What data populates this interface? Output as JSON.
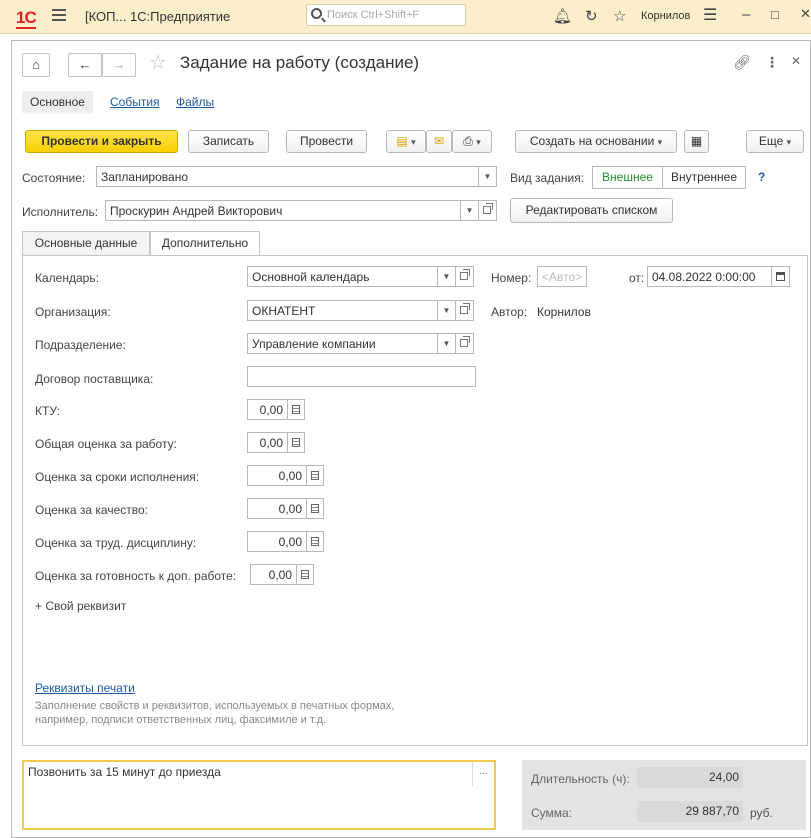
{
  "appbar": {
    "logo": "1С",
    "title": "[КОП... 1С:Предприятие",
    "search_placeholder": "Поиск Ctrl+Shift+F",
    "user": "Корнилов"
  },
  "window": {
    "title": "Задание на работу (создание)"
  },
  "top_tabs": [
    {
      "label": "Основное"
    },
    {
      "label": "События"
    },
    {
      "label": "Файлы"
    }
  ],
  "toolbar": {
    "post_close": "Провести и закрыть",
    "save": "Записать",
    "post": "Провести",
    "create_based": "Создать на основании",
    "more": "Еще"
  },
  "header": {
    "state_label": "Состояние:",
    "state_value": "Запланировано",
    "task_type_label": "Вид задания:",
    "task_type_external": "Внешнее",
    "task_type_internal": "Внутреннее",
    "help": "?",
    "executor_label": "Исполнитель:",
    "executor_value": "Проскурин Андрей Викторович",
    "edit_list": "Редактировать списком"
  },
  "inner_tabs": [
    {
      "label": "Основные данные"
    },
    {
      "label": "Дополнительно"
    }
  ],
  "details": {
    "calendar_label": "Календарь:",
    "calendar_value": "Основной календарь",
    "number_label": "Номер:",
    "number_placeholder": "<Авто>",
    "date_label": "от:",
    "date_value": "04.08.2022  0:00:00",
    "org_label": "Организация:",
    "org_value": "ОКНАТЕНТ",
    "author_label": "Автор:",
    "author_value": "Корнилов",
    "dept_label": "Подразделение:",
    "dept_value": "Управление компании",
    "contract_label": "Договор поставщика:",
    "contract_value": "",
    "ktu_label": "КТУ:",
    "ktu_value": "0,00",
    "overall_label": "Общая оценка за работу:",
    "overall_value": "0,00",
    "deadline_label": "Оценка за сроки исполнения:",
    "deadline_value": "0,00",
    "quality_label": "Оценка за качество:",
    "quality_value": "0,00",
    "discipline_label": "Оценка за труд. дисциплину:",
    "discipline_value": "0,00",
    "readiness_label": "Оценка за готовность к доп. работе:",
    "readiness_value": "0,00",
    "custom_attr": "+ Свой реквизит",
    "print_link": "Реквизиты печати",
    "print_desc": "Заполнение свойств и реквизитов, используемых в печатных формах, например, подписи ответственных лиц, факсимиле и т.д."
  },
  "comment": {
    "value": "Позвонить за 15 минут до приезда",
    "dots": "..."
  },
  "summary": {
    "duration_label": "Длительность (ч):",
    "duration_value": "24,00",
    "sum_label": "Сумма:",
    "sum_value": "29 887,70",
    "currency": "руб."
  }
}
